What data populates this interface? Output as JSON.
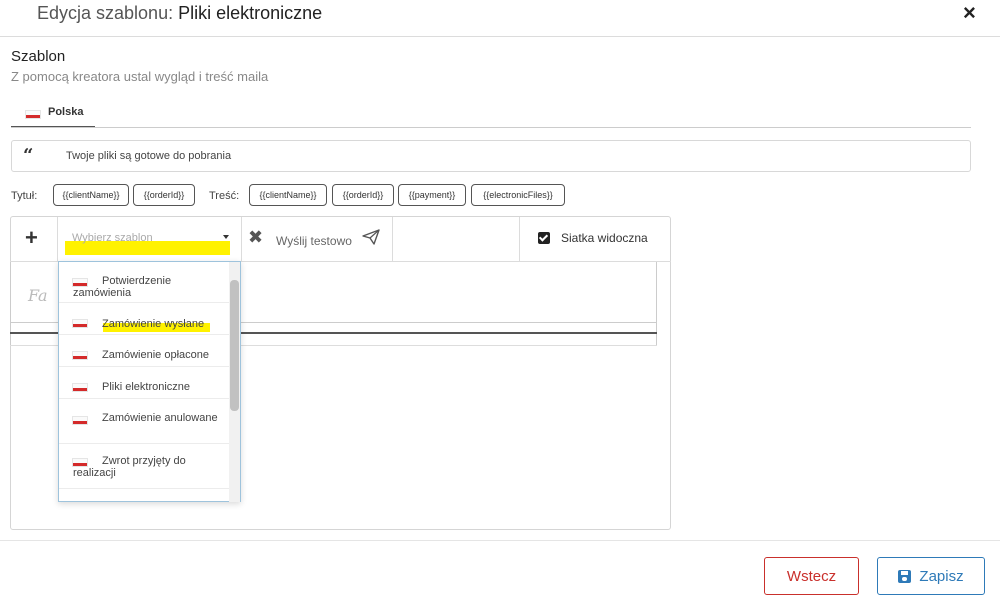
{
  "header": {
    "title_prefix": "Edycja szablonu: ",
    "title_name": "Pliki elektroniczne",
    "close_icon": "×"
  },
  "section": {
    "title": "Szablon",
    "subtitle": "Z pomocą kreatora ustal wygląd i treść maila"
  },
  "tabs": [
    {
      "label": "Polska",
      "icon": "flag-pl-icon",
      "active": true
    }
  ],
  "subject": {
    "icon": "quote-icon",
    "value": "Twoje pliki są gotowe do pobrania"
  },
  "placeholders": {
    "title_label": "Tytuł:",
    "title_chips": [
      "{{clientName}}",
      "{{orderId}}"
    ],
    "content_label": "Treść:",
    "content_chips": [
      "{{clientName}}",
      "{{orderId}}",
      "{{payment}}",
      "{{electronicFiles}}"
    ]
  },
  "toolbar": {
    "add_icon": "+",
    "template_select_placeholder": "Wybierz szablon",
    "clear_icon": "✖",
    "send_test_label": "Wyślij testowo",
    "send_icon": "paper-plane-icon",
    "grid_checked": true,
    "grid_label": "Siatka widoczna"
  },
  "dropdown": {
    "options": [
      {
        "label": "Potwierdzenie zamówienia",
        "highlighted": false
      },
      {
        "label": "Zamówienie wysłane",
        "highlighted": true
      },
      {
        "label": "Zamówienie opłacone",
        "highlighted": false
      },
      {
        "label": "Pliki elektroniczne",
        "highlighted": false
      },
      {
        "label": "Zamówienie anulowane",
        "highlighted": false
      },
      {
        "label": "Zwrot przyjęty do realizacji",
        "highlighted": false
      }
    ],
    "highlight_color": "#fff200"
  },
  "canvas": {
    "script_text": "Fa"
  },
  "footer": {
    "back_label": "Wstecz",
    "save_label": "Zapisz",
    "save_icon": "floppy-disk-icon",
    "back_color": "#c9302c",
    "save_color": "#2e7ab8"
  }
}
